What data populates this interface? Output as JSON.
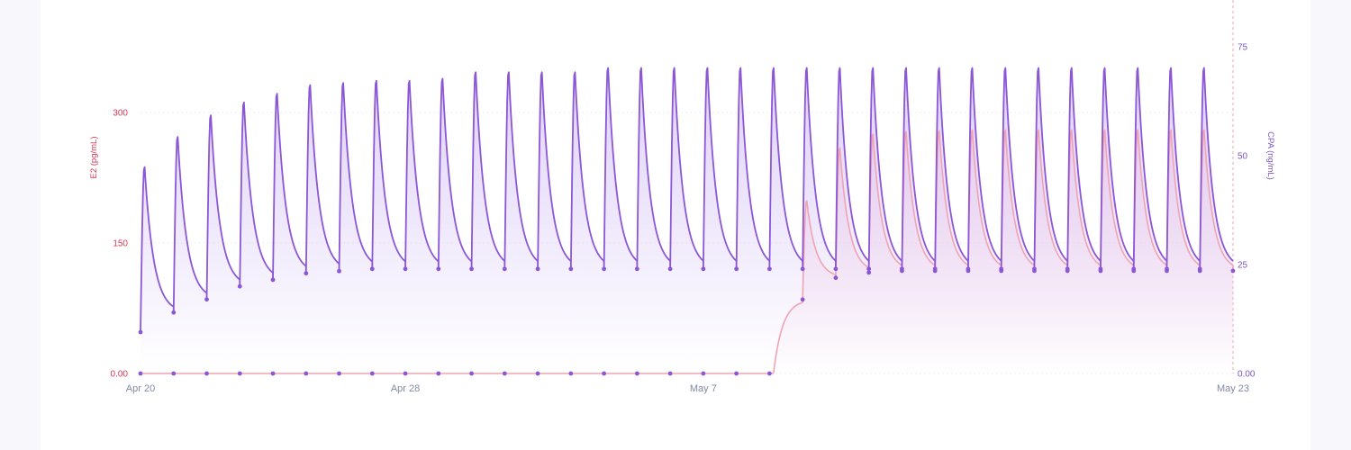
{
  "chart_data": {
    "type": "line",
    "x_range": [
      "2024-04-20",
      "2024-05-23"
    ],
    "x_ticks": [
      "Apr 20",
      "Apr 28",
      "May 7",
      "May 23"
    ],
    "y_left": {
      "label": "E2 (pg/mL)",
      "ticks": [
        "0.00",
        "150",
        "300"
      ],
      "range": [
        0,
        300
      ]
    },
    "y_right": {
      "label": "CPA (ng/mL)",
      "ticks": [
        "0.00",
        "25",
        "50",
        "75"
      ],
      "range": [
        0,
        75
      ]
    },
    "grid": true,
    "series": [
      {
        "color": "#f0a3b4",
        "axis": "left",
        "start_date": "2024-04-30",
        "dose_interval_days": 1,
        "trough": [
          0,
          0,
          0,
          0,
          0,
          0,
          0,
          0,
          0,
          0,
          85,
          110,
          116,
          118,
          118,
          118,
          118,
          118,
          118,
          118,
          118,
          118,
          118,
          118,
          118,
          118,
          118,
          118,
          118,
          118,
          118,
          118,
          118
        ],
        "peak": [
          0,
          0,
          0,
          0,
          0,
          0,
          0,
          0,
          0,
          0,
          200,
          262,
          278,
          281,
          282,
          283,
          283,
          283,
          283,
          283,
          283,
          283,
          283,
          283,
          283,
          283,
          283,
          283,
          283,
          283,
          283,
          283,
          283
        ]
      },
      {
        "color": "#8b57d6",
        "axis": "right",
        "start_date": "2024-04-20",
        "dose_interval_days": 1,
        "trough": [
          9.5,
          14,
          17,
          20,
          21.5,
          23,
          23.5,
          24,
          24,
          24,
          24,
          24,
          24,
          24,
          24,
          24,
          24,
          24,
          24,
          24,
          24,
          24,
          24,
          24,
          24,
          24,
          24,
          24,
          24,
          24,
          24,
          24,
          24
        ],
        "peak": [
          48,
          55,
          60,
          63,
          65,
          67,
          67.5,
          68,
          68,
          68.5,
          70,
          70,
          70,
          70,
          71,
          71,
          71,
          71,
          71,
          71,
          71,
          71,
          71,
          71,
          71,
          71,
          71,
          71,
          71,
          71,
          71,
          71,
          71
        ]
      }
    ],
    "marker": {
      "date": "2024-05-23",
      "color": "#f0a3b4"
    }
  }
}
